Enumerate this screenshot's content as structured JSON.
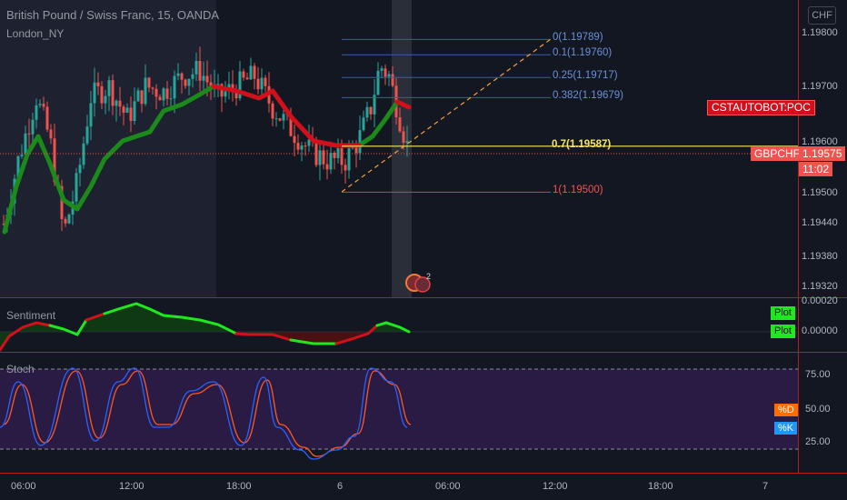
{
  "header": {
    "symbol_title": "British Pound / Swiss Franc, 15, OANDA",
    "session_indicator": "London_NY",
    "currency_button": "CHF"
  },
  "price_badges": {
    "bot_label": "CSTAUTOBOT:POC",
    "symbol": "GBPCHF",
    "last_price": "1.19575",
    "countdown": "11:02"
  },
  "colors": {
    "background": "#131722",
    "bull_candle": "#26a69a",
    "bear_candle": "#ef5350",
    "ma_green": "#1b8a1b",
    "ma_red": "#d1101c",
    "fib_line": "#3a5ba8",
    "fib_key_line": "#f5e663",
    "fib_base_line": "#e53935",
    "pane_border": "#b71c1c",
    "stoch_k": "#2962ff",
    "stoch_d": "#ff5722"
  },
  "chart_data": [
    {
      "type": "candlestick",
      "title": "British Pound / Swiss Franc, 15, OANDA",
      "y_axis_ticks": [
        "1.19800",
        "1.19700",
        "1.19600",
        "1.19500",
        "1.19440",
        "1.19380",
        "1.19320"
      ],
      "x_axis_ticks": [
        "06:00",
        "12:00",
        "18:00",
        "6",
        "06:00",
        "12:00",
        "18:00",
        "7"
      ],
      "last_price": 1.19575,
      "fibonacci_retracement": [
        {
          "level": "0",
          "price": 1.19789,
          "label": "0(1.19789)"
        },
        {
          "level": "0.1",
          "price": 1.1976,
          "label": "0.1(1.19760)"
        },
        {
          "level": "0.25",
          "price": 1.19717,
          "label": "0.25(1.19717)"
        },
        {
          "level": "0.382",
          "price": 1.19679,
          "label": "0.382(1.19679)"
        },
        {
          "level": "0.7",
          "price": 1.19587,
          "label": "0.7(1.19587)"
        },
        {
          "level": "1",
          "price": 1.195,
          "label": "1(1.19500)"
        }
      ],
      "events_badge_count": "2"
    },
    {
      "type": "line",
      "title": "Sentiment",
      "y_axis_ticks": [
        "0.00020",
        "0.00000"
      ],
      "legend": [
        "Plot",
        "Plot"
      ]
    },
    {
      "type": "line",
      "title": "Stoch",
      "y_axis_ticks": [
        "75.00",
        "50.00",
        "25.00"
      ],
      "upper_band": 80,
      "lower_band": 20,
      "legend": [
        "%D",
        "%K"
      ]
    }
  ]
}
